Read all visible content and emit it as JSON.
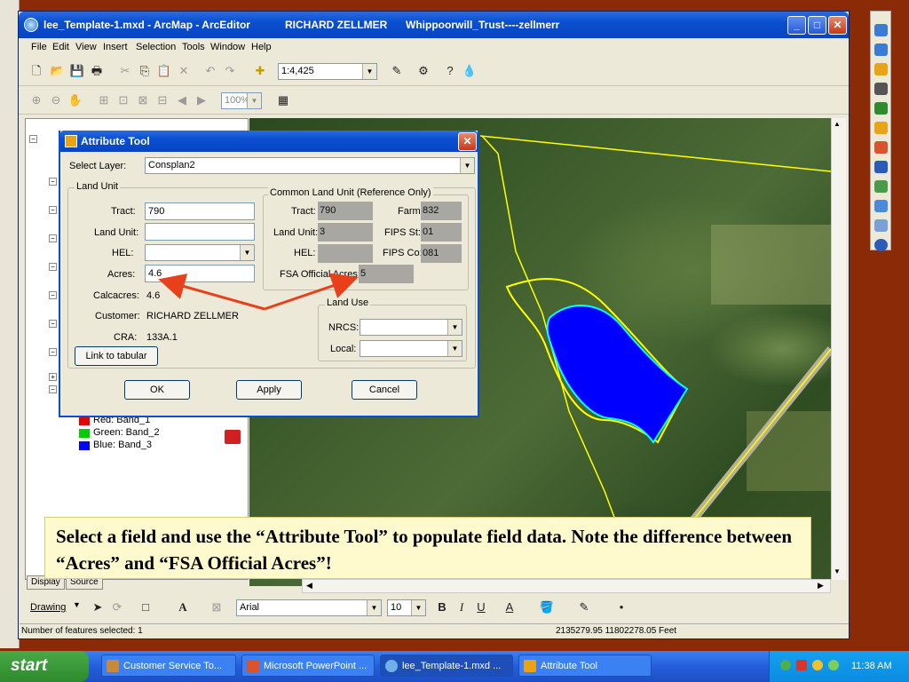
{
  "arcmap": {
    "title": "lee_Template-1.mxd - ArcMap - ArcEditor",
    "user": "RICHARD ZELLMER",
    "session": "Whippoorwill_Trust----zellmerr",
    "menus": [
      "File",
      "Edit",
      "View",
      "Insert",
      "Selection",
      "Tools",
      "Window",
      "Help"
    ],
    "scale": "1:4,425",
    "zoom": "100%"
  },
  "toc": {
    "legend": [
      {
        "label": "Red:   Band_1",
        "color": "#e00000"
      },
      {
        "label": "Green: Band_2",
        "color": "#00cc00"
      },
      {
        "label": "Blue:  Band_3",
        "color": "#0000ff"
      }
    ],
    "tabs": [
      "Display",
      "Source"
    ]
  },
  "attribute_tool": {
    "title": "Attribute Tool",
    "select_layer_label": "Select Layer:",
    "select_layer_value": "Consplan2",
    "land_unit_group": "Land Unit",
    "tract_label": "Tract:",
    "tract_value": "790",
    "land_unit_label": "Land Unit:",
    "land_unit_value": "",
    "hel_label": "HEL:",
    "hel_value": "",
    "acres_label": "Acres:",
    "acres_value": "4.6",
    "calcacres_label": "Calcacres:",
    "calcacres_value": "4.6",
    "customer_label": "Customer:",
    "customer_value": "RICHARD ZELLMER",
    "cra_label": "CRA:",
    "cra_value": "133A.1",
    "link_label": "Link to tabular",
    "clu_group": "Common Land Unit (Reference Only)",
    "clu_tract_label": "Tract:",
    "clu_tract_value": "790",
    "clu_farm_label": "Farm:",
    "clu_farm_value": "832",
    "clu_landunit_label": "Land Unit:",
    "clu_landunit_value": "3",
    "clu_fipsst_label": "FIPS St:",
    "clu_fipsst_value": "01",
    "clu_hel_label": "HEL:",
    "clu_hel_value": "",
    "clu_fipsco_label": "FIPS Co:",
    "clu_fipsco_value": "081",
    "fsa_label": "FSA Official Acres:",
    "fsa_value": "5",
    "land_use_group": "Land Use",
    "nrcs_label": "NRCS:",
    "local_label": "Local:",
    "ok_label": "OK",
    "apply_label": "Apply",
    "cancel_label": "Cancel"
  },
  "drawing_bar": {
    "drawing_label": "Drawing",
    "font": "Arial",
    "size": "10",
    "bold": "B",
    "italic": "I",
    "underline": "U",
    "font_color": "A"
  },
  "status": {
    "selected": "Number of features selected: 1",
    "coords": "2135279.95  11802278.05 Feet"
  },
  "caption": "Select a field and use the “Attribute Tool” to populate field data.  Note the difference between “Acres” and “FSA Official Acres”!",
  "taskbar": {
    "start": "start",
    "tasks": [
      "Customer Service To...",
      "Microsoft PowerPoint ...",
      "lee_Template-1.mxd ...",
      "Attribute Tool"
    ],
    "time": "11:38 AM"
  },
  "colors": {
    "pond": "#0000ff",
    "boundary": "#ffff00",
    "arrow": "#e8401a"
  }
}
